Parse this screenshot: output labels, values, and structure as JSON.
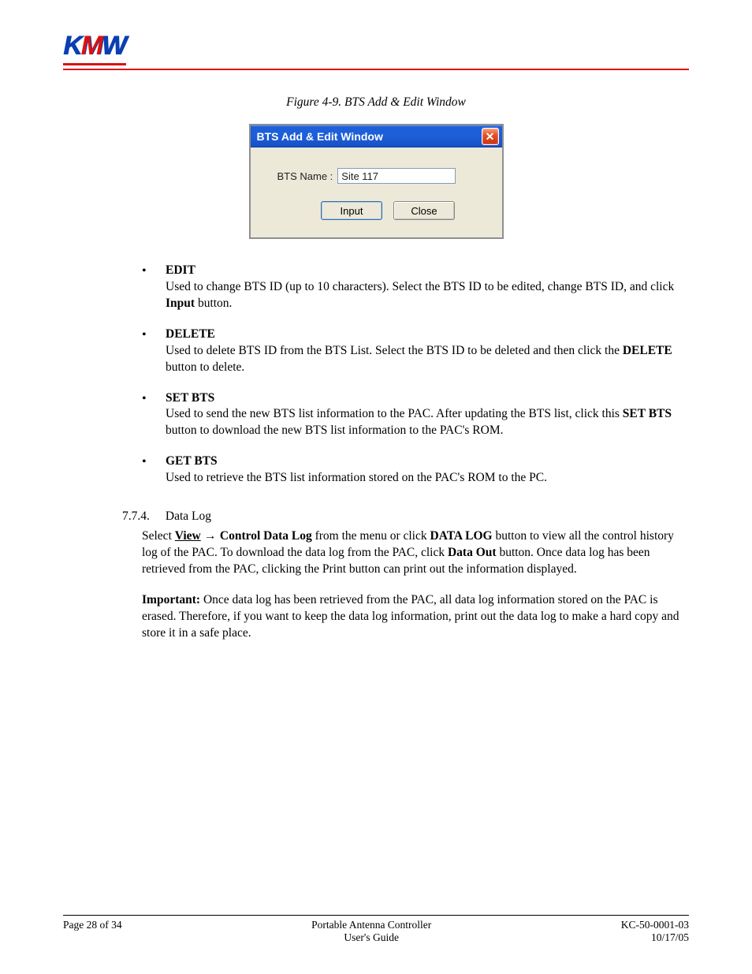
{
  "brand": {
    "k": "K",
    "m": "M",
    "w": "W"
  },
  "figure_caption": "Figure 4-9. BTS Add & Edit Window",
  "dialog": {
    "title": "BTS Add & Edit Window",
    "close_glyph": "✕",
    "field_label": "BTS Name :",
    "field_value": "Site 117",
    "btn_input": "Input",
    "btn_close": "Close"
  },
  "items": {
    "edit": {
      "title": "EDIT",
      "body_a": "Used to change BTS ID (up to 10 characters). Select the BTS ID to be edited, change BTS ID, and click ",
      "body_bold": "Input",
      "body_b": " button."
    },
    "delete": {
      "title": "DELETE",
      "body_a": "Used to delete BTS ID from the BTS List.  Select the BTS ID to be deleted and then click the ",
      "body_bold": "DELETE",
      "body_b": " button to delete."
    },
    "setbts": {
      "title": "SET BTS",
      "body_a": "Used to send the new BTS list information to the PAC. After updating the BTS list, click this ",
      "body_bold": "SET BTS",
      "body_b": " button to download the new BTS list information to the PAC's ROM."
    },
    "getbts": {
      "title": "GET BTS",
      "body": "Used to retrieve the BTS list information stored on the PAC's ROM to the PC."
    }
  },
  "section": {
    "num": "7.7.4.",
    "title": "Data Log",
    "p1_a": "Select ",
    "p1_view": "View",
    "p1_arrow": " → ",
    "p1_cdl": "Control Data Log",
    "p1_b": " from the menu or click ",
    "p1_datalog": "DATA LOG",
    "p1_c": " button to view all the control history log of the PAC. To download the data log from the PAC, click ",
    "p1_dataout": "Data Out",
    "p1_d": " button. Once data log has been retrieved from the PAC, clicking the Print button can print out the information displayed.",
    "p2_imp": "Important:",
    "p2_body": " Once data log has been retrieved from the PAC, all data log information stored on the PAC is erased. Therefore, if you want to keep the data log information, print out the data log to make a hard copy and store it in a safe place."
  },
  "footer": {
    "left": "Page 28 of 34",
    "center1": "Portable Antenna Controller",
    "center2": "User's Guide",
    "right1": "KC-50-0001-03",
    "right2": "10/17/05"
  }
}
